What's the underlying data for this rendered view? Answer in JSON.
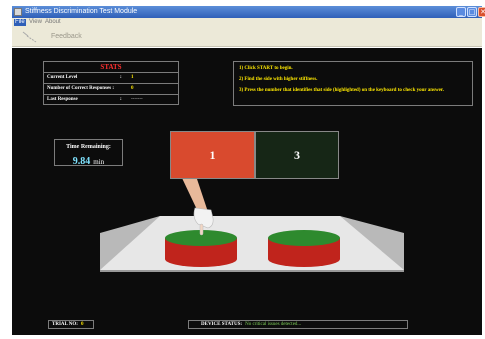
{
  "window": {
    "title": "Stiffness Discrimination Test Module",
    "controls": {
      "minimize": "_",
      "maximize": "□",
      "close": "✕"
    }
  },
  "menu": [
    "File",
    "View",
    "About"
  ],
  "toolbar": {
    "feedback_label": "Feedback"
  },
  "stats": {
    "title": "STATS",
    "rows": [
      {
        "label": "Current Level",
        "sep": ":",
        "value": "1"
      },
      {
        "label": "Number of Correct Responses :",
        "sep": "",
        "value": "0"
      },
      {
        "label": "Last Response",
        "sep": ":",
        "value": "-------"
      }
    ]
  },
  "instructions": [
    "1) Click START to begin.",
    "2) Find the side with higher stiffness.",
    "3) Press the number that identifies that side (highlighted) on the keyboard to check your answer."
  ],
  "timer": {
    "label": "Time Remaining:",
    "value": "9.84",
    "unit": "min"
  },
  "choices": [
    {
      "number": "1",
      "color": "#d94a2e",
      "highlighted": true
    },
    {
      "number": "3",
      "color": "#162616",
      "highlighted": false
    }
  ],
  "trial": {
    "label": "TRIAL NO:",
    "value": "0"
  },
  "device": {
    "label": "DEVICE STATUS:",
    "value": "No critical issues detected..."
  },
  "colors": {
    "accent_yellow": "#ffe900",
    "stats_header": "#ff3030",
    "timer_value": "#7fe3ff",
    "status_ok": "#7fd05a",
    "cylinder_top": "#2e8a2e",
    "cylinder_side": "#c0241c"
  }
}
